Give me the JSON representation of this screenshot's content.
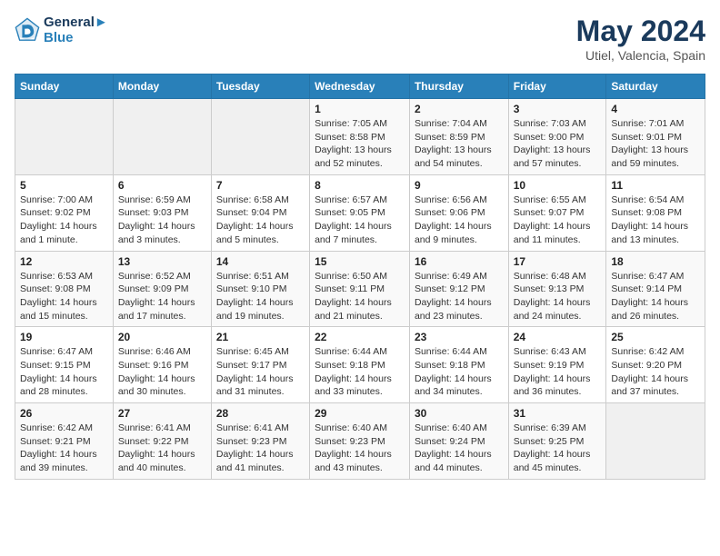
{
  "header": {
    "logo_line1": "General",
    "logo_line2": "Blue",
    "title": "May 2024",
    "subtitle": "Utiel, Valencia, Spain"
  },
  "days_of_week": [
    "Sunday",
    "Monday",
    "Tuesday",
    "Wednesday",
    "Thursday",
    "Friday",
    "Saturday"
  ],
  "weeks": [
    [
      {
        "day": "",
        "empty": true
      },
      {
        "day": "",
        "empty": true
      },
      {
        "day": "",
        "empty": true
      },
      {
        "day": "1",
        "sunrise": "7:05 AM",
        "sunset": "8:58 PM",
        "daylight": "13 hours and 52 minutes."
      },
      {
        "day": "2",
        "sunrise": "7:04 AM",
        "sunset": "8:59 PM",
        "daylight": "13 hours and 54 minutes."
      },
      {
        "day": "3",
        "sunrise": "7:03 AM",
        "sunset": "9:00 PM",
        "daylight": "13 hours and 57 minutes."
      },
      {
        "day": "4",
        "sunrise": "7:01 AM",
        "sunset": "9:01 PM",
        "daylight": "13 hours and 59 minutes."
      }
    ],
    [
      {
        "day": "5",
        "sunrise": "7:00 AM",
        "sunset": "9:02 PM",
        "daylight": "14 hours and 1 minute."
      },
      {
        "day": "6",
        "sunrise": "6:59 AM",
        "sunset": "9:03 PM",
        "daylight": "14 hours and 3 minutes."
      },
      {
        "day": "7",
        "sunrise": "6:58 AM",
        "sunset": "9:04 PM",
        "daylight": "14 hours and 5 minutes."
      },
      {
        "day": "8",
        "sunrise": "6:57 AM",
        "sunset": "9:05 PM",
        "daylight": "14 hours and 7 minutes."
      },
      {
        "day": "9",
        "sunrise": "6:56 AM",
        "sunset": "9:06 PM",
        "daylight": "14 hours and 9 minutes."
      },
      {
        "day": "10",
        "sunrise": "6:55 AM",
        "sunset": "9:07 PM",
        "daylight": "14 hours and 11 minutes."
      },
      {
        "day": "11",
        "sunrise": "6:54 AM",
        "sunset": "9:08 PM",
        "daylight": "14 hours and 13 minutes."
      }
    ],
    [
      {
        "day": "12",
        "sunrise": "6:53 AM",
        "sunset": "9:08 PM",
        "daylight": "14 hours and 15 minutes."
      },
      {
        "day": "13",
        "sunrise": "6:52 AM",
        "sunset": "9:09 PM",
        "daylight": "14 hours and 17 minutes."
      },
      {
        "day": "14",
        "sunrise": "6:51 AM",
        "sunset": "9:10 PM",
        "daylight": "14 hours and 19 minutes."
      },
      {
        "day": "15",
        "sunrise": "6:50 AM",
        "sunset": "9:11 PM",
        "daylight": "14 hours and 21 minutes."
      },
      {
        "day": "16",
        "sunrise": "6:49 AM",
        "sunset": "9:12 PM",
        "daylight": "14 hours and 23 minutes."
      },
      {
        "day": "17",
        "sunrise": "6:48 AM",
        "sunset": "9:13 PM",
        "daylight": "14 hours and 24 minutes."
      },
      {
        "day": "18",
        "sunrise": "6:47 AM",
        "sunset": "9:14 PM",
        "daylight": "14 hours and 26 minutes."
      }
    ],
    [
      {
        "day": "19",
        "sunrise": "6:47 AM",
        "sunset": "9:15 PM",
        "daylight": "14 hours and 28 minutes."
      },
      {
        "day": "20",
        "sunrise": "6:46 AM",
        "sunset": "9:16 PM",
        "daylight": "14 hours and 30 minutes."
      },
      {
        "day": "21",
        "sunrise": "6:45 AM",
        "sunset": "9:17 PM",
        "daylight": "14 hours and 31 minutes."
      },
      {
        "day": "22",
        "sunrise": "6:44 AM",
        "sunset": "9:18 PM",
        "daylight": "14 hours and 33 minutes."
      },
      {
        "day": "23",
        "sunrise": "6:44 AM",
        "sunset": "9:18 PM",
        "daylight": "14 hours and 34 minutes."
      },
      {
        "day": "24",
        "sunrise": "6:43 AM",
        "sunset": "9:19 PM",
        "daylight": "14 hours and 36 minutes."
      },
      {
        "day": "25",
        "sunrise": "6:42 AM",
        "sunset": "9:20 PM",
        "daylight": "14 hours and 37 minutes."
      }
    ],
    [
      {
        "day": "26",
        "sunrise": "6:42 AM",
        "sunset": "9:21 PM",
        "daylight": "14 hours and 39 minutes."
      },
      {
        "day": "27",
        "sunrise": "6:41 AM",
        "sunset": "9:22 PM",
        "daylight": "14 hours and 40 minutes."
      },
      {
        "day": "28",
        "sunrise": "6:41 AM",
        "sunset": "9:23 PM",
        "daylight": "14 hours and 41 minutes."
      },
      {
        "day": "29",
        "sunrise": "6:40 AM",
        "sunset": "9:23 PM",
        "daylight": "14 hours and 43 minutes."
      },
      {
        "day": "30",
        "sunrise": "6:40 AM",
        "sunset": "9:24 PM",
        "daylight": "14 hours and 44 minutes."
      },
      {
        "day": "31",
        "sunrise": "6:39 AM",
        "sunset": "9:25 PM",
        "daylight": "14 hours and 45 minutes."
      },
      {
        "day": "",
        "empty": true
      }
    ]
  ],
  "labels": {
    "sunrise": "Sunrise:",
    "sunset": "Sunset:",
    "daylight": "Daylight:"
  }
}
